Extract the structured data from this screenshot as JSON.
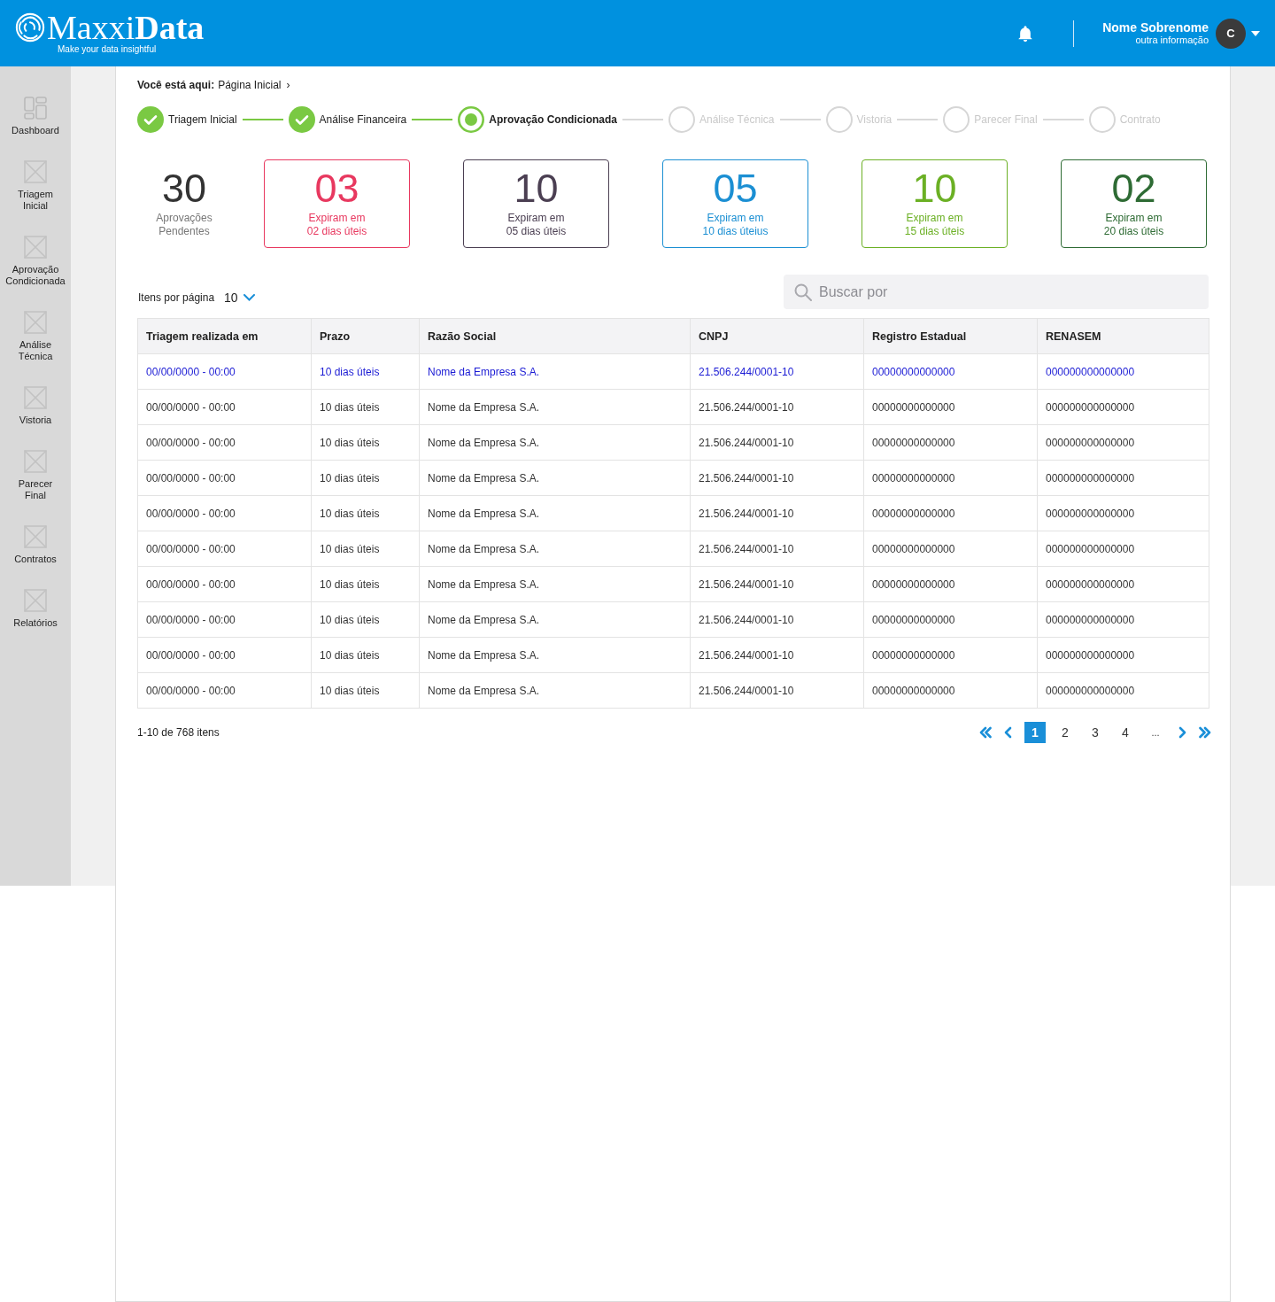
{
  "header": {
    "logo": {
      "wordmark": "Maxxi**Data**",
      "tagline": "Make your data insightful"
    },
    "user": {
      "name": "Nome Sobrenome",
      "info": "outra informação",
      "initial": "C"
    }
  },
  "sidebar": {
    "items": [
      {
        "label": "Dashboard",
        "kind": "dashboard",
        "selected": false
      },
      {
        "label": "Triagem Inicial",
        "kind": "placeholder",
        "selected": false
      },
      {
        "label": "Aprovação Condicionada",
        "kind": "placeholder",
        "selected": false
      },
      {
        "label": "Análise Técnica",
        "kind": "placeholder",
        "selected": false
      },
      {
        "label": "Vistoria",
        "kind": "placeholder",
        "selected": false
      },
      {
        "label": "Parecer Final",
        "kind": "placeholder",
        "selected": false
      },
      {
        "label": "Contratos",
        "kind": "placeholder",
        "selected": false
      },
      {
        "label": "Relatórios",
        "kind": "placeholder",
        "selected": false
      }
    ]
  },
  "breadcrumb": {
    "prefix": "Você está aqui:",
    "items": [
      {
        "label": "Página Inicial"
      }
    ],
    "separator": "›"
  },
  "steps": [
    {
      "label": "Triagem Inicial",
      "completed": true,
      "current": false
    },
    {
      "label": "Análise Financeira",
      "completed": true,
      "current": false
    },
    {
      "label": "Aprovação Condicionada",
      "completed": false,
      "current": true
    },
    {
      "label": "Análise Técnica",
      "completed": false,
      "current": false
    },
    {
      "label": "Vistoria",
      "completed": false,
      "current": false
    },
    {
      "label": "Parecer Final",
      "completed": false,
      "current": false
    },
    {
      "label": "Contrato",
      "completed": false,
      "current": false
    }
  ],
  "summary": {
    "total": {
      "value": "30",
      "caption": [
        "Aprovações",
        "Pendentes"
      ]
    },
    "cards": [
      {
        "value": "03",
        "caption": [
          "Expiram em",
          "02 dias úteis"
        ],
        "color": "#e8385f"
      },
      {
        "value": "10",
        "caption": [
          "Expiram em",
          "05 dias úteis"
        ],
        "color": "#4b3f52"
      },
      {
        "value": "05",
        "caption": [
          "Expiram em",
          "10 dias úteius"
        ],
        "color": "#1b8fd3"
      },
      {
        "value": "10",
        "caption": [
          "Expiram em",
          "15 dias úteis"
        ],
        "color": "#6bb024"
      },
      {
        "value": "02",
        "caption": [
          "Expiram em",
          "20 dias úteis"
        ],
        "color": "#2e6b34"
      }
    ]
  },
  "list_controls": {
    "items_per_page": {
      "label": "Itens por página",
      "value": "10"
    },
    "search": {
      "placeholder": "Buscar por"
    }
  },
  "table": {
    "columns": [
      "Triagem realizada em",
      "Prazo",
      "Razão Social",
      "CNPJ",
      "Registro Estadual",
      "RENASEM"
    ],
    "rows": [
      {
        "selected": true,
        "cells": [
          "00/00/0000 - 00:00",
          "10 dias úteis",
          "Nome da Empresa S.A.",
          "21.506.244/0001-10",
          "00000000000000",
          "000000000000000"
        ]
      },
      {
        "selected": false,
        "cells": [
          "00/00/0000 - 00:00",
          "10 dias úteis",
          "Nome da Empresa S.A.",
          "21.506.244/0001-10",
          "00000000000000",
          "000000000000000"
        ]
      },
      {
        "selected": false,
        "cells": [
          "00/00/0000 - 00:00",
          "10 dias úteis",
          "Nome da Empresa S.A.",
          "21.506.244/0001-10",
          "00000000000000",
          "000000000000000"
        ]
      },
      {
        "selected": false,
        "cells": [
          "00/00/0000 - 00:00",
          "10 dias úteis",
          "Nome da Empresa S.A.",
          "21.506.244/0001-10",
          "00000000000000",
          "000000000000000"
        ]
      },
      {
        "selected": false,
        "cells": [
          "00/00/0000 - 00:00",
          "10 dias úteis",
          "Nome da Empresa S.A.",
          "21.506.244/0001-10",
          "00000000000000",
          "000000000000000"
        ]
      },
      {
        "selected": false,
        "cells": [
          "00/00/0000 - 00:00",
          "10 dias úteis",
          "Nome da Empresa S.A.",
          "21.506.244/0001-10",
          "00000000000000",
          "000000000000000"
        ]
      },
      {
        "selected": false,
        "cells": [
          "00/00/0000 - 00:00",
          "10 dias úteis",
          "Nome da Empresa S.A.",
          "21.506.244/0001-10",
          "00000000000000",
          "000000000000000"
        ]
      },
      {
        "selected": false,
        "cells": [
          "00/00/0000 - 00:00",
          "10 dias úteis",
          "Nome da Empresa S.A.",
          "21.506.244/0001-10",
          "00000000000000",
          "000000000000000"
        ]
      },
      {
        "selected": false,
        "cells": [
          "00/00/0000 - 00:00",
          "10 dias úteis",
          "Nome da Empresa S.A.",
          "21.506.244/0001-10",
          "00000000000000",
          "000000000000000"
        ]
      },
      {
        "selected": false,
        "cells": [
          "00/00/0000 - 00:00",
          "10 dias úteis",
          "Nome da Empresa S.A.",
          "21.506.244/0001-10",
          "00000000000000",
          "000000000000000"
        ]
      }
    ]
  },
  "pagination": {
    "summary": "1-10 de 768 itens",
    "pages": [
      {
        "label": "1",
        "selected": true
      },
      {
        "label": "2",
        "selected": false
      },
      {
        "label": "3",
        "selected": false
      },
      {
        "label": "4",
        "selected": false
      }
    ],
    "ellipsis": "..."
  }
}
